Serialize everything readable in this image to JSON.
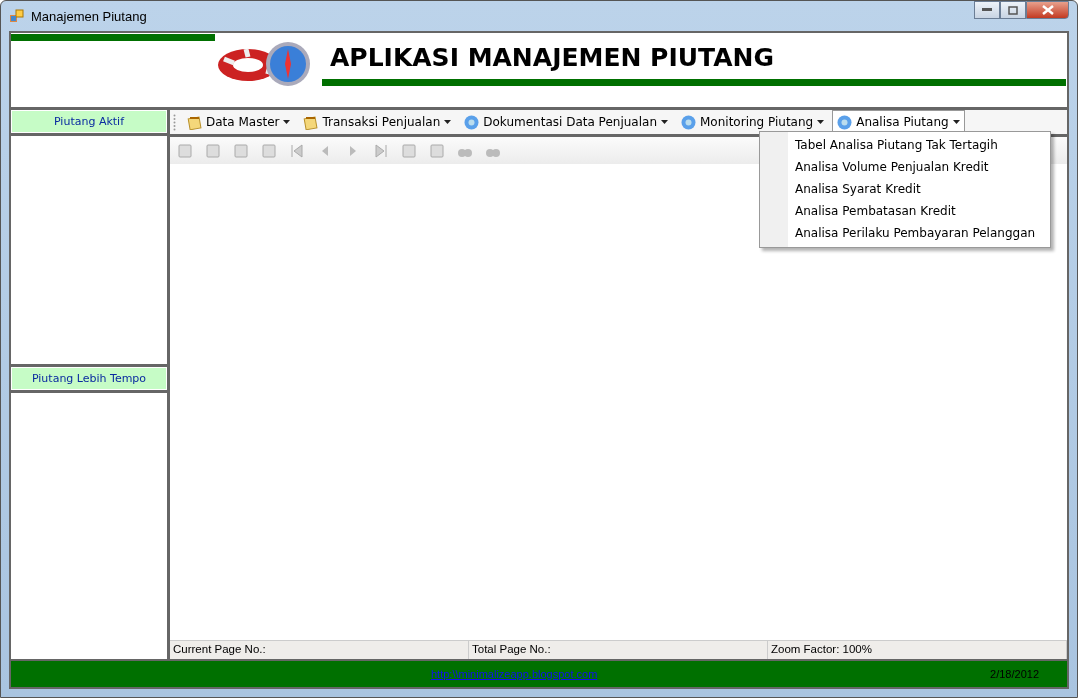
{
  "window": {
    "title": "Manajemen Piutang"
  },
  "header": {
    "title": "APLIKASI MANAJEMEN PIUTANG"
  },
  "side_panels": [
    {
      "title": "Piutang Aktif"
    },
    {
      "title": "Piutang Lebih Tempo"
    }
  ],
  "menu": [
    {
      "label": "Data Master",
      "kind": "master",
      "selected": false
    },
    {
      "label": "Transaksi Penjualan",
      "kind": "master",
      "selected": false
    },
    {
      "label": "Dokumentasi Data Penjualan",
      "kind": "report",
      "selected": false
    },
    {
      "label": "Monitoring Piutang",
      "kind": "report",
      "selected": false
    },
    {
      "label": "Analisa Piutang",
      "kind": "report",
      "selected": true
    }
  ],
  "dropdown": [
    "Tabel Analisa Piutang Tak Tertagih",
    "Analisa Volume Penjualan Kredit",
    "Analisa Syarat Kredit",
    "Analisa Pembatasan Kredit",
    "Analisa Perilaku Pembayaran Pelanggan"
  ],
  "status_bar": [
    "Current Page No.:",
    "Total Page No.:",
    "Zoom Factor: 100%"
  ],
  "footer": {
    "link": "http:\\\\minimalizeapp.blogspot.com",
    "date": "2/18/2012"
  }
}
